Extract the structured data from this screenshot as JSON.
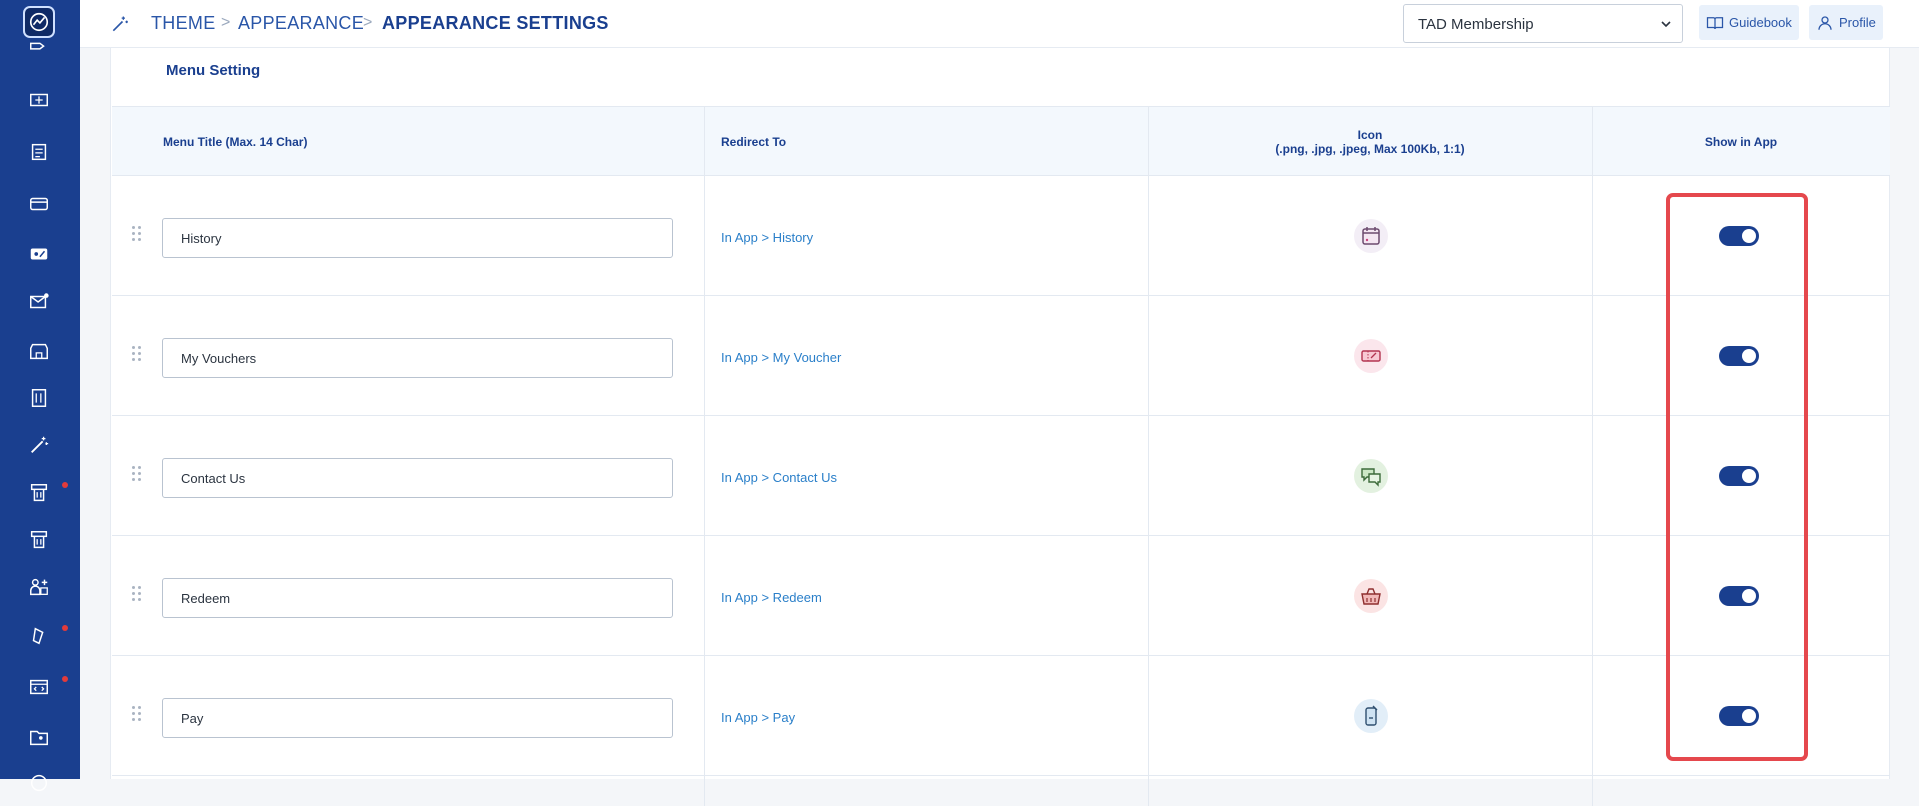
{
  "breadcrumb": {
    "items": [
      "THEME",
      "APPEARANCE",
      "APPEARANCE SETTINGS"
    ],
    "separator": ">"
  },
  "header": {
    "membership_select": "TAD Membership",
    "guidebook_label": "Guidebook",
    "profile_label": "Profile"
  },
  "card": {
    "title": "Menu Setting"
  },
  "table": {
    "headers": {
      "menu_title": "Menu Title (Max. 14 Char)",
      "redirect_to": "Redirect To",
      "icon_line1": "Icon",
      "icon_line2": "(.png, .jpg, .jpeg, Max 100Kb, 1:1)",
      "show_in_app": "Show in App"
    },
    "rows": [
      {
        "title": "History",
        "redirect": "In App > History",
        "icon": "calendar-icon",
        "show": true
      },
      {
        "title": "My Vouchers",
        "redirect": "In App > My Voucher",
        "icon": "voucher-icon",
        "show": true
      },
      {
        "title": "Contact Us",
        "redirect": "In App > Contact Us",
        "icon": "chat-bubbles-icon",
        "show": true
      },
      {
        "title": "Redeem",
        "redirect": "In App > Redeem",
        "icon": "basket-icon",
        "show": true
      },
      {
        "title": "Pay",
        "redirect": "In App > Pay",
        "icon": "phone-pay-icon",
        "show": true
      }
    ]
  },
  "colors": {
    "sidebar": "#1a3f8f",
    "accent": "#1a3f8f",
    "link": "#2a7fc9",
    "highlight": "#e5484d"
  }
}
